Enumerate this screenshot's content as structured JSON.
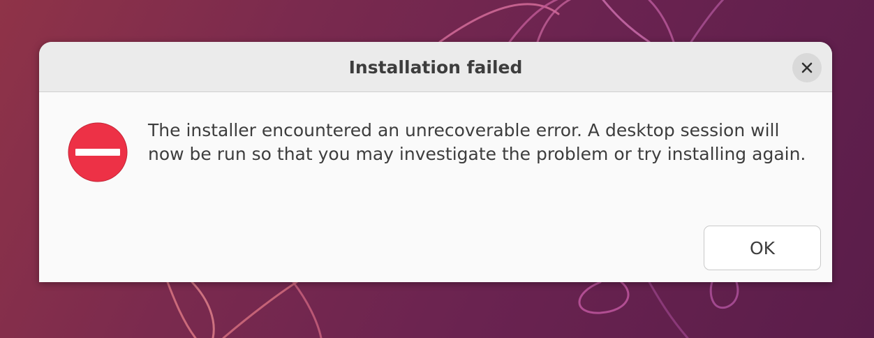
{
  "dialog": {
    "title": "Installation failed",
    "message": "The installer encountered an unrecoverable error.  A desktop session will now be run so that you may investigate the problem or try installing again.",
    "ok_label": "OK",
    "close_icon": "close-icon",
    "status_icon": "error-stop-icon"
  },
  "colors": {
    "error_red": "#ed3146",
    "titlebar_bg": "#ebebeb",
    "dialog_bg": "#fafafa",
    "text": "#3d3d3d"
  }
}
